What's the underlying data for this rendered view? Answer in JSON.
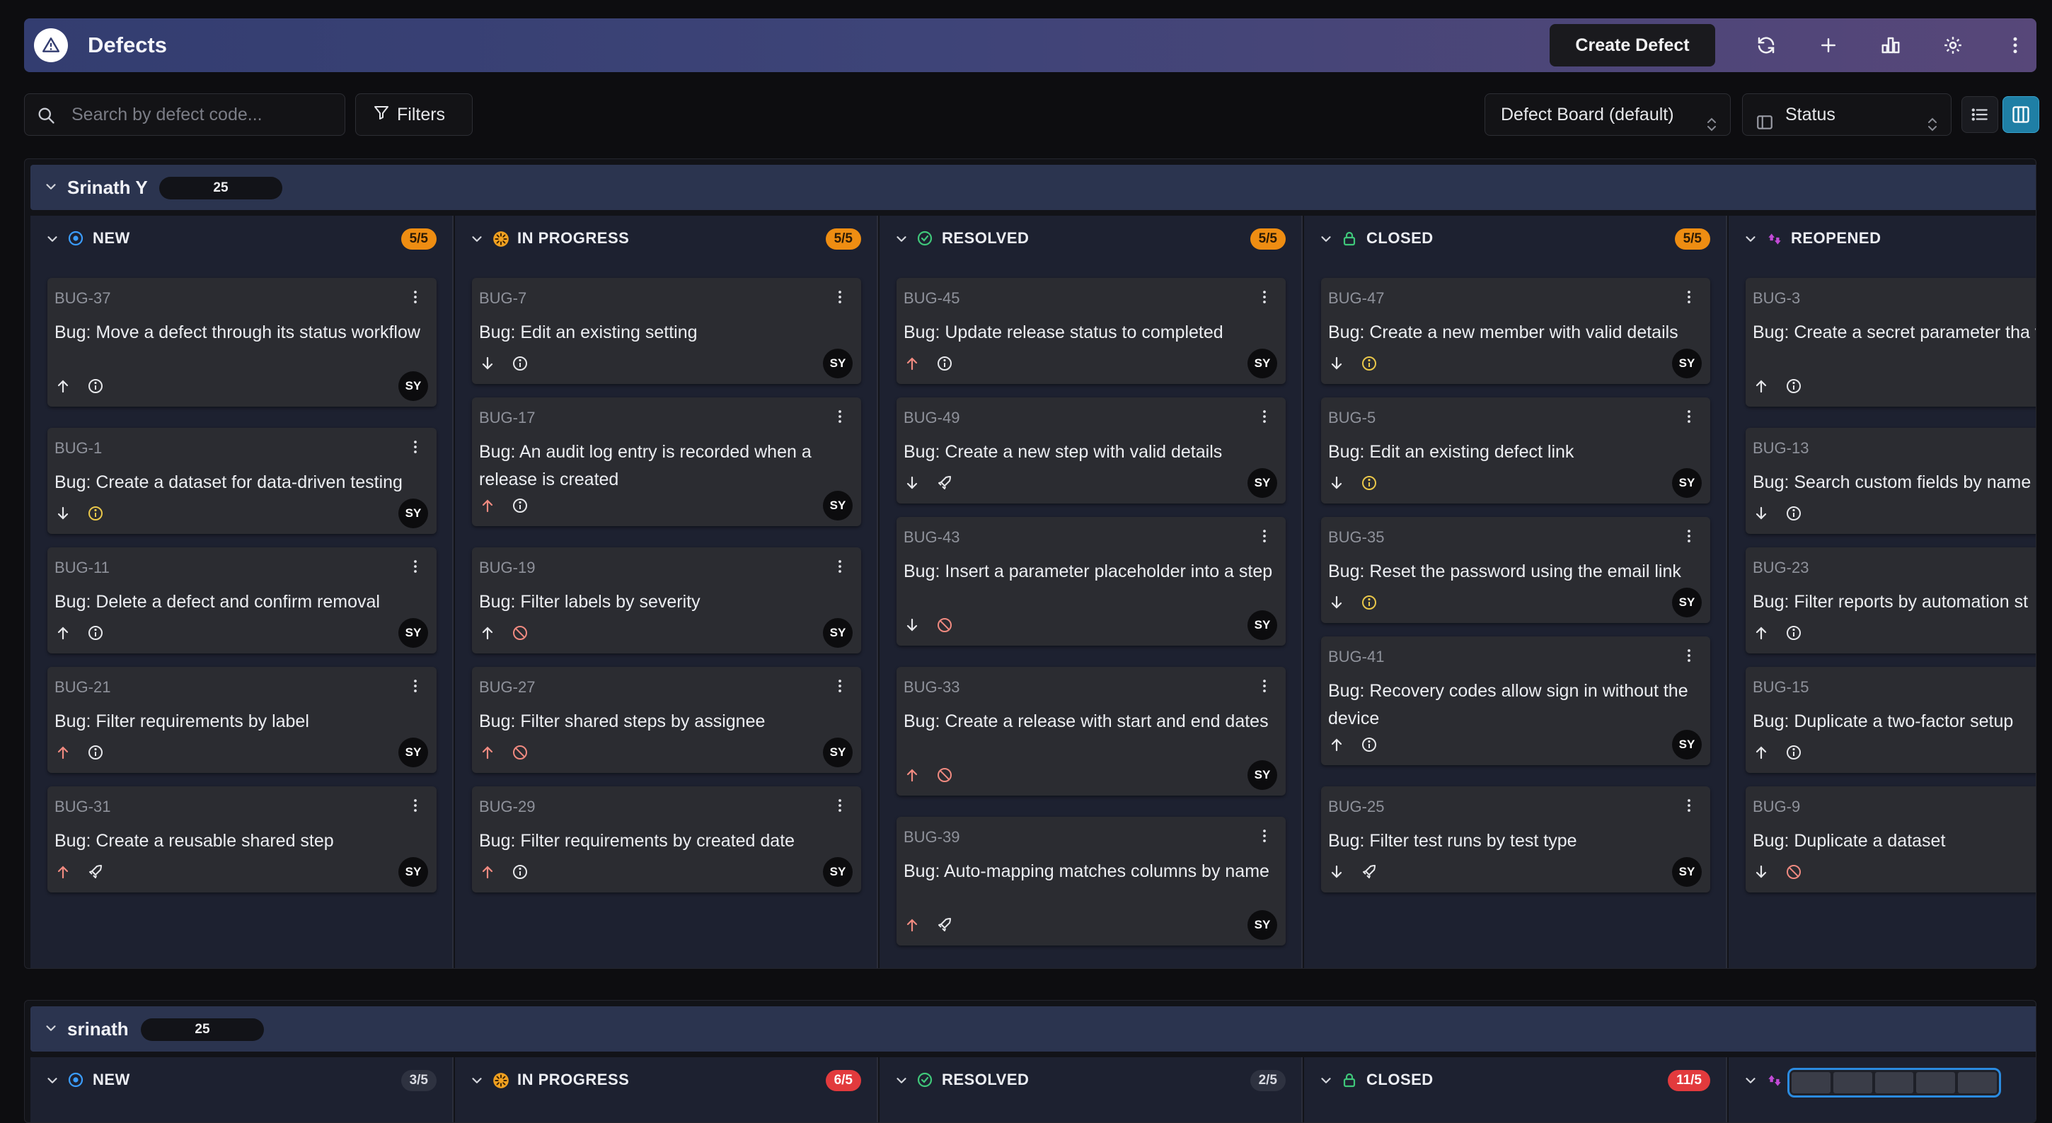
{
  "header": {
    "title": "Defects",
    "create_label": "Create Defect",
    "icons": [
      "refresh-icon",
      "plus-icon",
      "chart-icon",
      "gear-icon",
      "more-vertical-icon"
    ]
  },
  "toolbar": {
    "search_placeholder": "Search by defect code...",
    "filters_label": "Filters",
    "board_select": "Defect Board (default)",
    "group_select": "Status"
  },
  "colors": {
    "new": "#3b9dff",
    "in_progress": "#f0a020",
    "resolved": "#3fc77a",
    "closed": "#3fc77a",
    "reopened": "#c24ad6",
    "badge_orange": "#ee8d12",
    "badge_red": "#e23a3d",
    "priority_up": "#f08a80",
    "severity_warn": "#e9c74a"
  },
  "groups": [
    {
      "name": "Srinath Y",
      "count": "25",
      "columns": [
        {
          "title": "NEW",
          "wip": "5/5",
          "cards": [
            {
              "code": "BUG-37",
              "title": "Bug: Move a defect through its status workflow",
              "avatar": "SY"
            },
            {
              "code": "BUG-1",
              "title": "Bug: Create a dataset for data-driven testing",
              "avatar": "SY"
            },
            {
              "code": "BUG-11",
              "title": "Bug: Delete a defect and confirm removal",
              "avatar": "SY"
            },
            {
              "code": "BUG-21",
              "title": "Bug: Filter requirements by label",
              "avatar": "SY"
            },
            {
              "code": "BUG-31",
              "title": "Bug: Create a reusable shared step",
              "avatar": "SY"
            }
          ]
        },
        {
          "title": "IN PROGRESS",
          "wip": "5/5",
          "cards": [
            {
              "code": "BUG-7",
              "title": "Bug: Edit an existing setting",
              "avatar": "SY"
            },
            {
              "code": "BUG-17",
              "title": "Bug: An audit log entry is recorded when a release is created",
              "avatar": "SY"
            },
            {
              "code": "BUG-19",
              "title": "Bug: Filter labels by severity",
              "avatar": "SY"
            },
            {
              "code": "BUG-27",
              "title": "Bug: Filter shared steps by assignee",
              "avatar": "SY"
            },
            {
              "code": "BUG-29",
              "title": "Bug: Filter requirements by created date",
              "avatar": "SY"
            }
          ]
        },
        {
          "title": "RESOLVED",
          "wip": "5/5",
          "cards": [
            {
              "code": "BUG-45",
              "title": "Bug: Update release status to completed",
              "avatar": "SY"
            },
            {
              "code": "BUG-49",
              "title": "Bug: Create a new step with valid details",
              "avatar": "SY"
            },
            {
              "code": "BUG-43",
              "title": "Bug: Insert a parameter placeholder into a step",
              "avatar": "SY"
            },
            {
              "code": "BUG-33",
              "title": "Bug: Create a release with start and end dates",
              "avatar": "SY"
            },
            {
              "code": "BUG-39",
              "title": "Bug: Auto-mapping matches columns by name",
              "avatar": "SY"
            }
          ]
        },
        {
          "title": "CLOSED",
          "wip": "5/5",
          "cards": [
            {
              "code": "BUG-47",
              "title": "Bug: Create a new member with valid details",
              "avatar": "SY"
            },
            {
              "code": "BUG-5",
              "title": "Bug: Edit an existing defect link",
              "avatar": "SY"
            },
            {
              "code": "BUG-35",
              "title": "Bug: Reset the password using the email link",
              "avatar": "SY"
            },
            {
              "code": "BUG-41",
              "title": "Bug: Recovery codes allow sign in without the device",
              "avatar": "SY"
            },
            {
              "code": "BUG-25",
              "title": "Bug: Filter test runs by test type",
              "avatar": "SY"
            }
          ]
        },
        {
          "title": "REOPENED",
          "wip": "",
          "cards": [
            {
              "code": "BUG-3",
              "title": "Bug: Create a secret parameter tha value",
              "avatar": ""
            },
            {
              "code": "BUG-13",
              "title": "Bug: Search custom fields by name",
              "avatar": ""
            },
            {
              "code": "BUG-23",
              "title": "Bug: Filter reports by automation st",
              "avatar": ""
            },
            {
              "code": "BUG-15",
              "title": "Bug: Duplicate a two-factor setup",
              "avatar": ""
            },
            {
              "code": "BUG-9",
              "title": "Bug: Duplicate a dataset",
              "avatar": ""
            }
          ]
        }
      ]
    },
    {
      "name": "srinath",
      "count": "25",
      "columns": [
        {
          "title": "NEW",
          "wip": "3/5",
          "cards": []
        },
        {
          "title": "IN PROGRESS",
          "wip": "6/5",
          "cards": []
        },
        {
          "title": "RESOLVED",
          "wip": "2/5",
          "cards": []
        },
        {
          "title": "CLOSED",
          "wip": "11/5",
          "cards": []
        },
        {
          "title": "",
          "wip": "",
          "cards": []
        }
      ]
    }
  ]
}
